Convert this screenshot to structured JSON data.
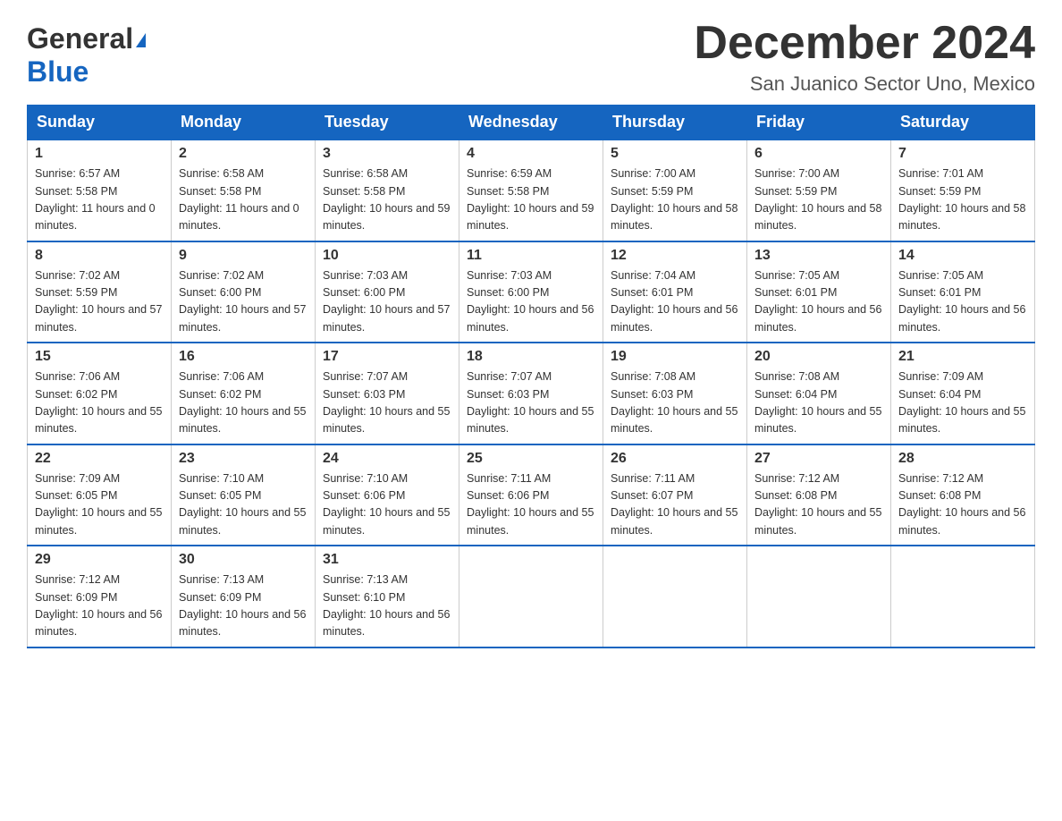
{
  "logo": {
    "part1": "General",
    "triangle": "▶",
    "part2": "Blue"
  },
  "title": "December 2024",
  "location": "San Juanico Sector Uno, Mexico",
  "days_of_week": [
    "Sunday",
    "Monday",
    "Tuesday",
    "Wednesday",
    "Thursday",
    "Friday",
    "Saturday"
  ],
  "weeks": [
    [
      {
        "day": "1",
        "sunrise": "6:57 AM",
        "sunset": "5:58 PM",
        "daylight": "11 hours and 0 minutes."
      },
      {
        "day": "2",
        "sunrise": "6:58 AM",
        "sunset": "5:58 PM",
        "daylight": "11 hours and 0 minutes."
      },
      {
        "day": "3",
        "sunrise": "6:58 AM",
        "sunset": "5:58 PM",
        "daylight": "10 hours and 59 minutes."
      },
      {
        "day": "4",
        "sunrise": "6:59 AM",
        "sunset": "5:58 PM",
        "daylight": "10 hours and 59 minutes."
      },
      {
        "day": "5",
        "sunrise": "7:00 AM",
        "sunset": "5:59 PM",
        "daylight": "10 hours and 58 minutes."
      },
      {
        "day": "6",
        "sunrise": "7:00 AM",
        "sunset": "5:59 PM",
        "daylight": "10 hours and 58 minutes."
      },
      {
        "day": "7",
        "sunrise": "7:01 AM",
        "sunset": "5:59 PM",
        "daylight": "10 hours and 58 minutes."
      }
    ],
    [
      {
        "day": "8",
        "sunrise": "7:02 AM",
        "sunset": "5:59 PM",
        "daylight": "10 hours and 57 minutes."
      },
      {
        "day": "9",
        "sunrise": "7:02 AM",
        "sunset": "6:00 PM",
        "daylight": "10 hours and 57 minutes."
      },
      {
        "day": "10",
        "sunrise": "7:03 AM",
        "sunset": "6:00 PM",
        "daylight": "10 hours and 57 minutes."
      },
      {
        "day": "11",
        "sunrise": "7:03 AM",
        "sunset": "6:00 PM",
        "daylight": "10 hours and 56 minutes."
      },
      {
        "day": "12",
        "sunrise": "7:04 AM",
        "sunset": "6:01 PM",
        "daylight": "10 hours and 56 minutes."
      },
      {
        "day": "13",
        "sunrise": "7:05 AM",
        "sunset": "6:01 PM",
        "daylight": "10 hours and 56 minutes."
      },
      {
        "day": "14",
        "sunrise": "7:05 AM",
        "sunset": "6:01 PM",
        "daylight": "10 hours and 56 minutes."
      }
    ],
    [
      {
        "day": "15",
        "sunrise": "7:06 AM",
        "sunset": "6:02 PM",
        "daylight": "10 hours and 55 minutes."
      },
      {
        "day": "16",
        "sunrise": "7:06 AM",
        "sunset": "6:02 PM",
        "daylight": "10 hours and 55 minutes."
      },
      {
        "day": "17",
        "sunrise": "7:07 AM",
        "sunset": "6:03 PM",
        "daylight": "10 hours and 55 minutes."
      },
      {
        "day": "18",
        "sunrise": "7:07 AM",
        "sunset": "6:03 PM",
        "daylight": "10 hours and 55 minutes."
      },
      {
        "day": "19",
        "sunrise": "7:08 AM",
        "sunset": "6:03 PM",
        "daylight": "10 hours and 55 minutes."
      },
      {
        "day": "20",
        "sunrise": "7:08 AM",
        "sunset": "6:04 PM",
        "daylight": "10 hours and 55 minutes."
      },
      {
        "day": "21",
        "sunrise": "7:09 AM",
        "sunset": "6:04 PM",
        "daylight": "10 hours and 55 minutes."
      }
    ],
    [
      {
        "day": "22",
        "sunrise": "7:09 AM",
        "sunset": "6:05 PM",
        "daylight": "10 hours and 55 minutes."
      },
      {
        "day": "23",
        "sunrise": "7:10 AM",
        "sunset": "6:05 PM",
        "daylight": "10 hours and 55 minutes."
      },
      {
        "day": "24",
        "sunrise": "7:10 AM",
        "sunset": "6:06 PM",
        "daylight": "10 hours and 55 minutes."
      },
      {
        "day": "25",
        "sunrise": "7:11 AM",
        "sunset": "6:06 PM",
        "daylight": "10 hours and 55 minutes."
      },
      {
        "day": "26",
        "sunrise": "7:11 AM",
        "sunset": "6:07 PM",
        "daylight": "10 hours and 55 minutes."
      },
      {
        "day": "27",
        "sunrise": "7:12 AM",
        "sunset": "6:08 PM",
        "daylight": "10 hours and 55 minutes."
      },
      {
        "day": "28",
        "sunrise": "7:12 AM",
        "sunset": "6:08 PM",
        "daylight": "10 hours and 56 minutes."
      }
    ],
    [
      {
        "day": "29",
        "sunrise": "7:12 AM",
        "sunset": "6:09 PM",
        "daylight": "10 hours and 56 minutes."
      },
      {
        "day": "30",
        "sunrise": "7:13 AM",
        "sunset": "6:09 PM",
        "daylight": "10 hours and 56 minutes."
      },
      {
        "day": "31",
        "sunrise": "7:13 AM",
        "sunset": "6:10 PM",
        "daylight": "10 hours and 56 minutes."
      },
      null,
      null,
      null,
      null
    ]
  ]
}
